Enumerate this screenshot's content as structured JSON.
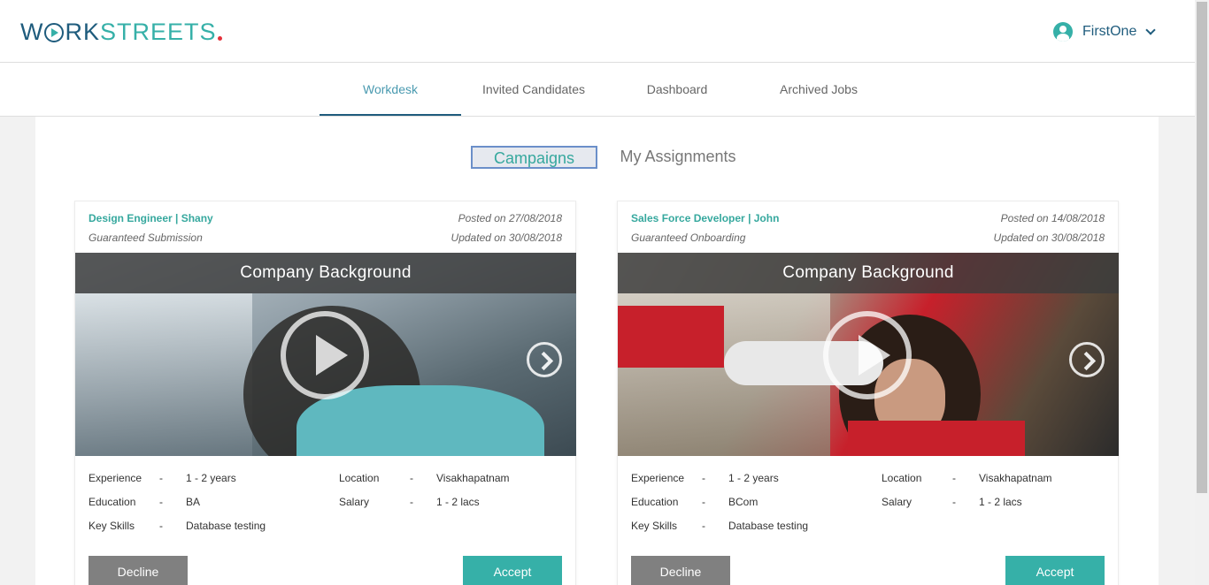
{
  "header": {
    "logo": {
      "part1": "W",
      "part2": "RK",
      "part3": "STREETS",
      "accent_dot_color": "#e5303a"
    },
    "user": {
      "name": "FirstOne"
    }
  },
  "nav": {
    "tabs": [
      {
        "label": "Workdesk",
        "active": true
      },
      {
        "label": "Invited Candidates",
        "active": false
      },
      {
        "label": "Dashboard",
        "active": false
      },
      {
        "label": "Archived Jobs",
        "active": false
      }
    ]
  },
  "segments": {
    "campaigns": "Campaigns",
    "assignments": "My Assignments",
    "selected": "Campaigns"
  },
  "cards": [
    {
      "title": "Design Engineer | Shany",
      "guarantee": "Guaranteed Submission",
      "posted": "Posted on 27/08/2018",
      "updated": "Updated on 30/08/2018",
      "video_caption": "Company Background",
      "details": {
        "experience_label": "Experience",
        "experience": "1 - 2 years",
        "education_label": "Education",
        "education": "BA",
        "skills_label": "Key Skills",
        "skills": "Database testing",
        "location_label": "Location",
        "location": "Visakhapatnam",
        "salary_label": "Salary",
        "salary": "1 - 2 lacs",
        "sep": "-"
      },
      "decline": "Decline",
      "accept": "Accept"
    },
    {
      "title": "Sales Force Developer | John",
      "guarantee": "Guaranteed Onboarding",
      "posted": "Posted on 14/08/2018",
      "updated": "Updated on 30/08/2018",
      "video_caption": "Company Background",
      "details": {
        "experience_label": "Experience",
        "experience": "1 - 2 years",
        "education_label": "Education",
        "education": "BCom",
        "skills_label": "Key Skills",
        "skills": "Database testing",
        "location_label": "Location",
        "location": "Visakhapatnam",
        "salary_label": "Salary",
        "salary": "1 - 2 lacs",
        "sep": "-"
      },
      "decline": "Decline",
      "accept": "Accept"
    }
  ],
  "colors": {
    "brand_dark": "#1f5c7d",
    "brand_teal": "#36b0a8",
    "decline_gray": "#808080"
  }
}
